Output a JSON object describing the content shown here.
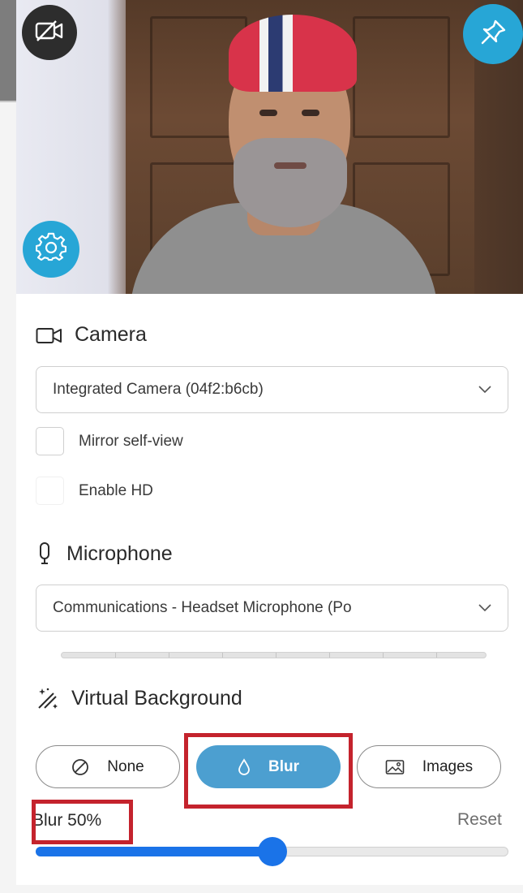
{
  "colors": {
    "accent": "#27a6d6",
    "active_pill": "#4c9fd0",
    "slider": "#1a73e8",
    "highlight": "#c4232d"
  },
  "preview": {
    "camera_off_icon": "camera-off-icon",
    "pin_icon": "pin-icon",
    "settings_icon": "gear-icon"
  },
  "camera": {
    "title": "Camera",
    "icon": "camera-icon",
    "device": "Integrated Camera (04f2:b6cb)",
    "mirror_label": "Mirror self-view",
    "hd_label": "Enable HD"
  },
  "microphone": {
    "title": "Microphone",
    "icon": "microphone-icon",
    "device": "Communications - Headset Microphone (Po"
  },
  "virtual_background": {
    "title": "Virtual Background",
    "icon": "magic-wand-icon",
    "options": [
      {
        "label": "None",
        "icon": "no-entry-icon",
        "selected": false
      },
      {
        "label": "Blur",
        "icon": "droplet-icon",
        "selected": true
      },
      {
        "label": "Images",
        "icon": "image-icon",
        "selected": false
      }
    ],
    "blur_label": "Blur 50%",
    "reset_label": "Reset",
    "blur_level": 0.5
  }
}
